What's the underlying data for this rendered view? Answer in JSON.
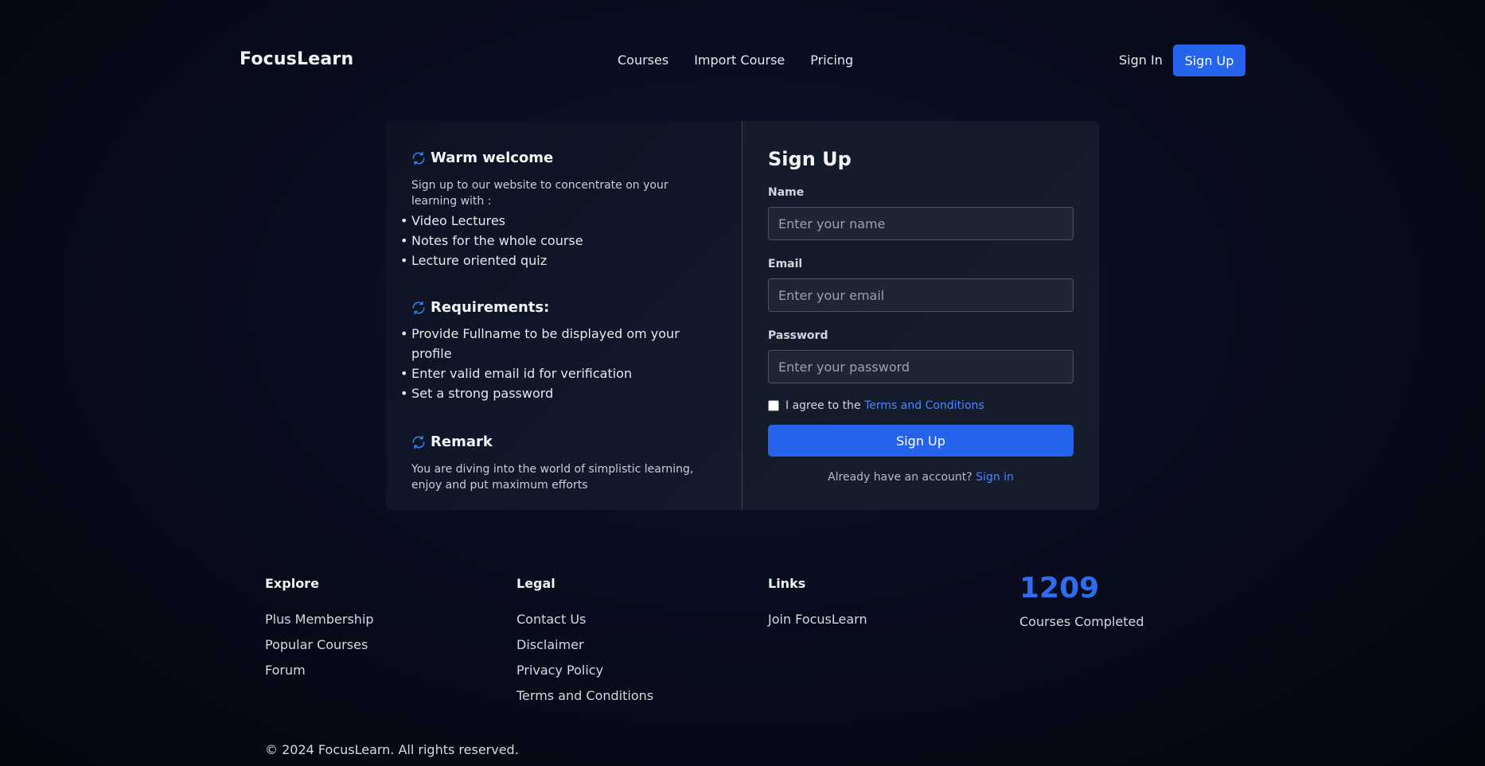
{
  "brand": "FocusLearn",
  "nav": {
    "links": [
      "Courses",
      "Import Course",
      "Pricing"
    ],
    "sign_in": "Sign In",
    "sign_up": "Sign Up"
  },
  "info": {
    "welcome": {
      "title": "Warm welcome",
      "desc": "Sign up to our website to concentrate on your learning with :",
      "items": [
        "Video Lectures",
        "Notes for the whole course",
        "Lecture oriented quiz"
      ]
    },
    "requirements": {
      "title": "Requirements:",
      "items": [
        "Provide Fullname to be displayed om your profile",
        "Enter valid email id for verification",
        "Set a strong password"
      ]
    },
    "remark": {
      "title": "Remark",
      "desc": "You are diving into the world of simplistic learning, enjoy and put maximum efforts"
    }
  },
  "form": {
    "title": "Sign Up",
    "name_label": "Name",
    "name_placeholder": "Enter your name",
    "email_label": "Email",
    "email_placeholder": "Enter your email",
    "password_label": "Password",
    "password_placeholder": "Enter your password",
    "agree_text": "I agree to the",
    "terms_link": "Terms and Conditions",
    "terms_checked": false,
    "submit": "Sign Up",
    "already_text": "Already have an account?",
    "signin_link": "Sign in"
  },
  "footer": {
    "explore": {
      "title": "Explore",
      "items": [
        "Plus Membership",
        "Popular Courses",
        "Forum"
      ]
    },
    "legal": {
      "title": "Legal",
      "items": [
        "Contact Us",
        "Disclaimer",
        "Privacy Policy",
        "Terms and Conditions"
      ]
    },
    "links": {
      "title": "Links",
      "items": [
        "Join FocusLearn"
      ]
    },
    "stat": {
      "value": "1209",
      "label": "Courses Completed"
    },
    "copyright": "© 2024 FocusLearn. All rights reserved."
  },
  "colors": {
    "accent": "#2563eb",
    "link": "#4a86ff",
    "stat": "#2f6cf0"
  },
  "icons": {
    "section": "sync-icon"
  }
}
